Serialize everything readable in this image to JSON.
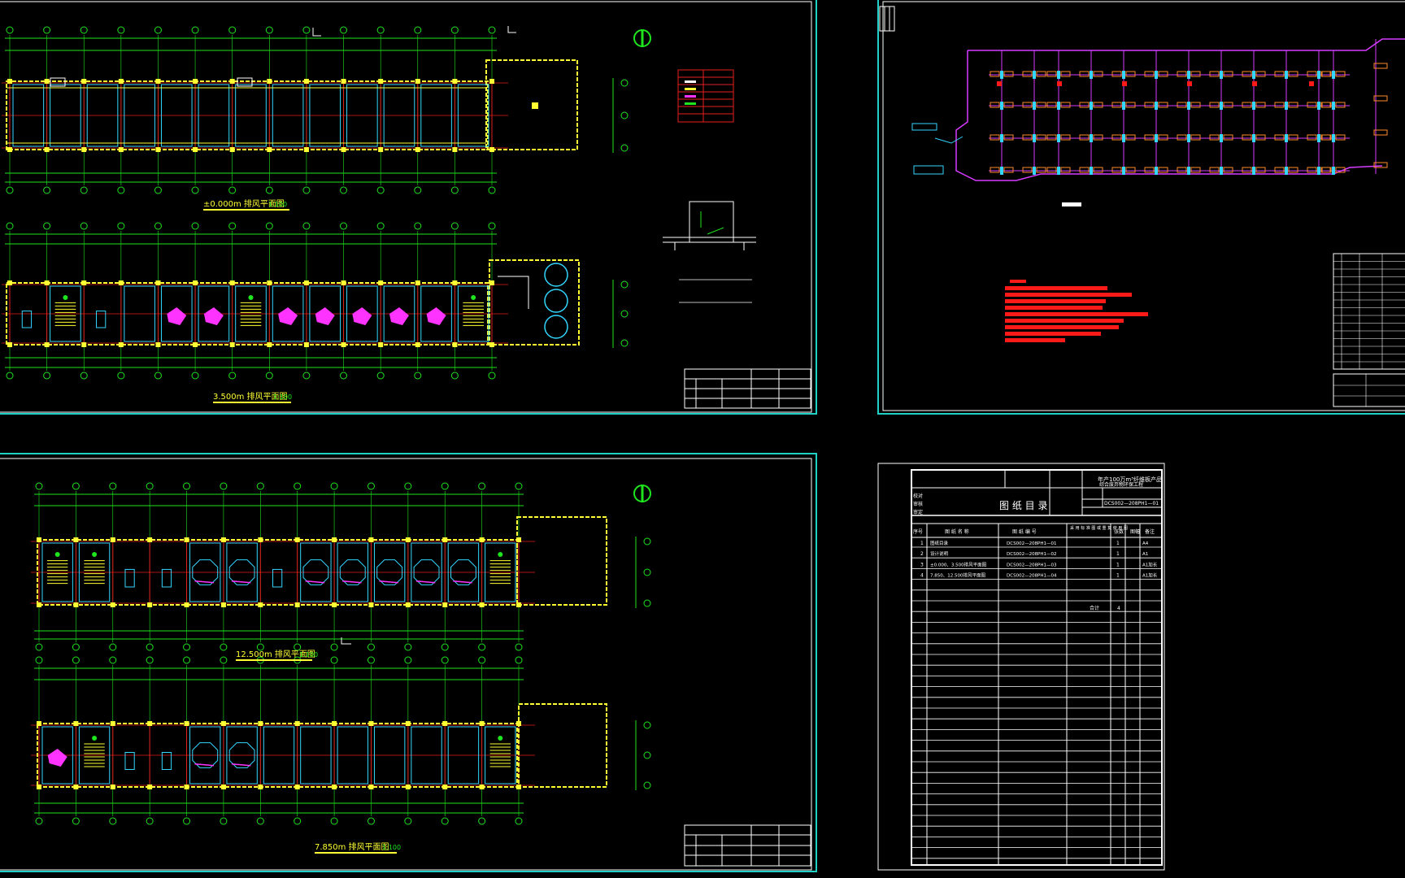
{
  "colors": {
    "background": "#000000",
    "sheet_border": "#1fd0c4",
    "grid": "#1ee51e",
    "axis": "#e51e1e",
    "wall": "#ffff33",
    "magenta": "#ff33ff",
    "white": "#ffffff",
    "cyan": "#33d6ff",
    "orange": "#ff8a2a",
    "blue": "#2a5bff"
  },
  "sheet1": {
    "plan1_title": "±0.000m 排风平面图",
    "plan1_scale": "1:100",
    "plan2_title": "3.500m 排风平面图",
    "plan2_scale": "1:100",
    "north_symbol": "north-arrow-icon"
  },
  "sheet2": {
    "plan3_title": "12.500m 排风平面图",
    "plan3_scale": "1:100",
    "plan4_title": "7.850m 排风平面图",
    "plan4_scale": "1:100",
    "north_symbol": "north-arrow-icon"
  },
  "drawing_list": {
    "title": "图 纸 目 录",
    "project_line1": "年产100万m³纤维板产品",
    "project_line2": "综合废弃物环保工程",
    "drawing_no": "DCS002—208PH1—01",
    "side_labels": [
      "校对",
      "审核",
      "审定"
    ],
    "columns": [
      "序号",
      "图 纸 名 称",
      "图 纸 编 号",
      "采 用 标 准 图 或 重 复 使 用 图",
      "张数",
      "图幅",
      "备注"
    ],
    "rows": [
      {
        "no": "1",
        "name": "图纸目录",
        "code": "DCS002—208PH1—01",
        "count": "1",
        "size": "A4"
      },
      {
        "no": "2",
        "name": "设计说明",
        "code": "DCS002—208PH1—02",
        "count": "1",
        "size": "A1"
      },
      {
        "no": "3",
        "name": "±0.000、3.500排风平面图",
        "code": "DCS002—208PH1—03",
        "count": "1",
        "size": "A1加长"
      },
      {
        "no": "4",
        "name": "7.850、12.500排风平面图",
        "code": "DCS002—208PH1—04",
        "count": "1",
        "size": "A1加长"
      }
    ],
    "total_label": "合计",
    "total_value": "4"
  }
}
